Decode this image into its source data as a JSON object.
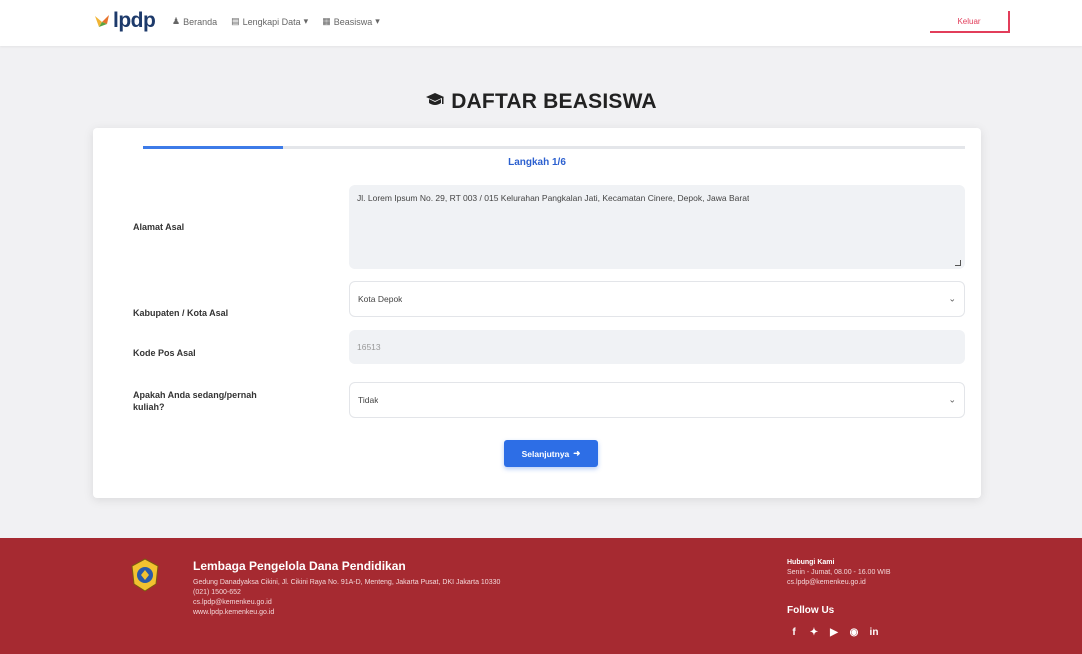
{
  "navbar": {
    "logo_text": "lpdp",
    "links": [
      {
        "label": "Beranda",
        "icon": "user-icon"
      },
      {
        "label": "Lengkapi Data",
        "icon": "document-icon",
        "has_dropdown": true
      },
      {
        "label": "Beasiswa",
        "icon": "grid-icon",
        "has_dropdown": true
      }
    ],
    "logout_label": "Keluar"
  },
  "page": {
    "title": "DAFTAR BEASISWA",
    "title_icon": "graduation-cap-icon",
    "progress_percent": 17,
    "step_label": "Langkah 1/6"
  },
  "form": {
    "fields": [
      {
        "label": "Alamat Asal",
        "value": "Jl. Lorem Ipsum No. 29, RT 003 / 015 Kelurahan Pangkalan Jati, Kecamatan Cinere, Depok, Jawa Barat",
        "type": "textarea"
      },
      {
        "label": "Kabupaten / Kota Asal",
        "value": "Kota Depok",
        "type": "select"
      },
      {
        "label": "Kode Pos Asal",
        "value": "16513",
        "type": "readonly"
      },
      {
        "label": "Apakah Anda sedang/pernah kuliah?",
        "value": "Tidak",
        "type": "select"
      }
    ],
    "next_label": "Selanjutnya"
  },
  "footer": {
    "org_name": "Lembaga Pengelola Dana Pendidikan",
    "address": "Gedung Danadyaksa Cikini, Jl. Cikini Raya No. 91A-D, Menteng, Jakarta Pusat, DKI Jakarta 10330",
    "phone": "(021) 1500-652",
    "email": "cs.lpdp@kemenkeu.go.id",
    "website": "www.lpdp.kemenkeu.go.id",
    "contact_title": "Hubungi Kami",
    "contact_lines": [
      "Senin - Jumat, 08.00 - 16.00 WIB",
      "cs.lpdp@kemenkeu.go.id"
    ],
    "follow_label": "Follow Us",
    "socials": [
      "facebook-icon",
      "twitter-icon",
      "youtube-icon",
      "instagram-icon",
      "linkedin-icon"
    ],
    "colors": {
      "footer_bg": "#a62a31",
      "accent": "#2d6ee6",
      "logout": "#e23d5a"
    }
  }
}
